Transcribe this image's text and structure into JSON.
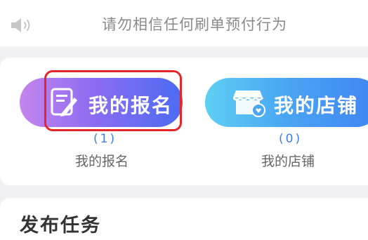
{
  "notice": {
    "icon": "speaker-icon",
    "text": "请勿相信任何刷单预付行为"
  },
  "actions": {
    "signup": {
      "icon": "signup-form-icon",
      "button_label": "我的报名",
      "count": "(1)",
      "caption": "我的报名",
      "gradient": [
        "#c685ee",
        "#4b6bf3"
      ]
    },
    "shop": {
      "icon": "shop-icon",
      "button_label": "我的店铺",
      "count": "(0)",
      "caption": "我的店铺",
      "gradient": [
        "#5fd0f4",
        "#3f83f2"
      ]
    }
  },
  "section": {
    "title": "发布任务"
  },
  "highlight_color": "#e3262a"
}
